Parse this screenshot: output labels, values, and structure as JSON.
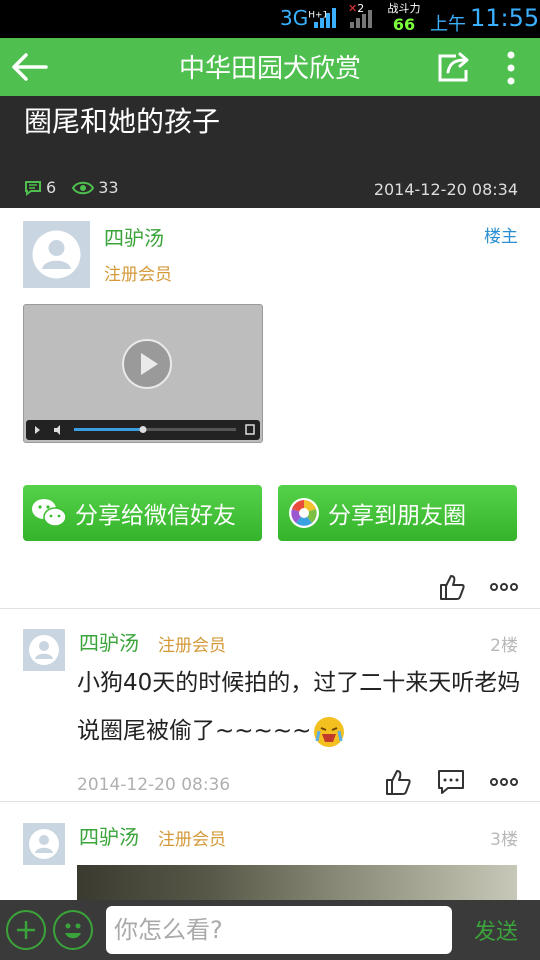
{
  "status_bar": {
    "network": "3G",
    "network_sup": "H+1",
    "sim2_sup": "2",
    "game_label": "战斗力",
    "game_value": "66",
    "ampm": "上午",
    "time": "11:55"
  },
  "title_bar": {
    "title": "中华田园犬欣赏",
    "icons": [
      "back-arrow-icon",
      "share-icon",
      "more-vertical-icon"
    ]
  },
  "post": {
    "title": "圈尾和她的孩子",
    "comment_count": "6",
    "view_count": "33",
    "date": "2014-12-20 08:34",
    "author": "四驴汤",
    "author_role": "注册会员",
    "owner_badge": "楼主",
    "share_wechat": "分享给微信好友",
    "share_moments": "分享到朋友圈"
  },
  "replies": [
    {
      "author": "四驴汤",
      "role": "注册会员",
      "floor": "2楼",
      "text": "小狗40天的时候拍的，过了二十来天听老妈说圈尾被偷了~~~~~",
      "date": "2014-12-20 08:36"
    },
    {
      "author": "四驴汤",
      "role": "注册会员",
      "floor": "3楼"
    }
  ],
  "bottom_bar": {
    "placeholder": "你怎么看?",
    "send_label": "发送"
  },
  "colors": {
    "accent_green": "#4fbf4f",
    "link_blue": "#2a8fd0",
    "role_orange": "#d49a3a",
    "dark_header": "#2b2b2b"
  }
}
